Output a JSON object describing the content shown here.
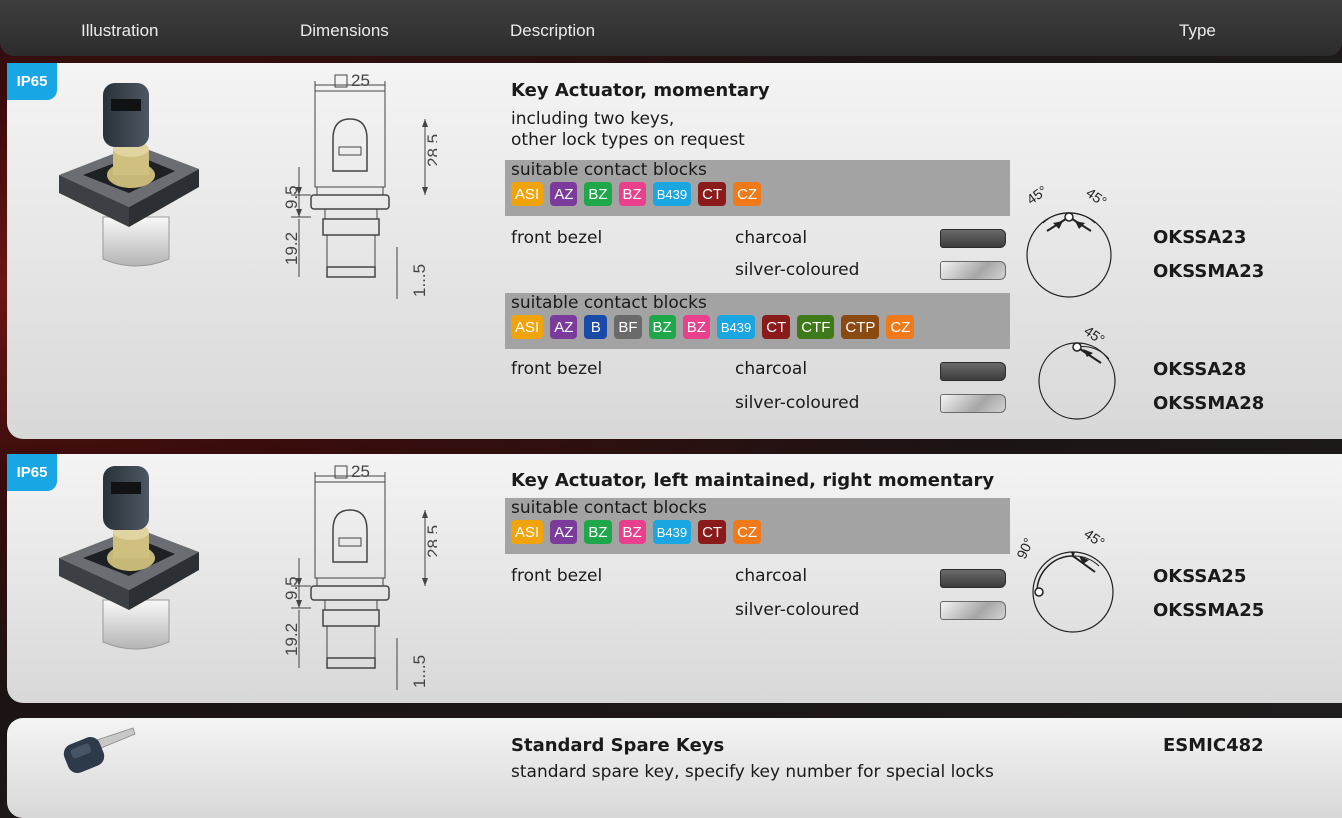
{
  "header": {
    "illustration": "Illustration",
    "dimensions": "Dimensions",
    "description": "Description",
    "type": "Type"
  },
  "dims": {
    "square": "25",
    "h_top": "28.5",
    "h_mid": "9.5",
    "h_bottom": "19.2",
    "h_range": "1...5"
  },
  "products": [
    {
      "badge": "IP65",
      "title": "Key Actuator, momentary",
      "desc1": "including two keys,",
      "desc2": "other lock types on request",
      "groups": [
        {
          "label": "suitable contact blocks",
          "chips": [
            {
              "text": "ASI",
              "color": "#f0a30a"
            },
            {
              "text": "AZ",
              "color": "#7a3b9a"
            },
            {
              "text": "BZ",
              "color": "#1ea84a"
            },
            {
              "text": "BZ",
              "color": "#e8408c"
            },
            {
              "text": "B439",
              "color": "#1aa6e0"
            },
            {
              "text": "CT",
              "color": "#8b1a1a"
            },
            {
              "text": "CZ",
              "color": "#f07a1a"
            }
          ],
          "bezel_label": "front bezel",
          "charcoal": "charcoal",
          "silver": "silver-coloured",
          "type_charcoal": "OKSSA23",
          "type_silver": "OKSSMA23",
          "angle_left": "45°",
          "angle_right": "45°"
        },
        {
          "label": "suitable contact blocks",
          "chips": [
            {
              "text": "ASI",
              "color": "#f0a30a"
            },
            {
              "text": "AZ",
              "color": "#7a3b9a"
            },
            {
              "text": "B",
              "color": "#1a4aa8"
            },
            {
              "text": "BF",
              "color": "#6a6a6a"
            },
            {
              "text": "BZ",
              "color": "#1ea84a"
            },
            {
              "text": "BZ",
              "color": "#e8408c"
            },
            {
              "text": "B439",
              "color": "#1aa6e0"
            },
            {
              "text": "CT",
              "color": "#8b1a1a"
            },
            {
              "text": "CTF",
              "color": "#3e7a1a"
            },
            {
              "text": "CTP",
              "color": "#8a4a12"
            },
            {
              "text": "CZ",
              "color": "#f07a1a"
            }
          ],
          "bezel_label": "front bezel",
          "charcoal": "charcoal",
          "silver": "silver-coloured",
          "type_charcoal": "OKSSA28",
          "type_silver": "OKSSMA28",
          "angle_right": "45°"
        }
      ]
    },
    {
      "badge": "IP65",
      "title": "Key Actuator, left maintained, right momentary",
      "groups": [
        {
          "label": "suitable contact blocks",
          "chips": [
            {
              "text": "ASI",
              "color": "#f0a30a"
            },
            {
              "text": "AZ",
              "color": "#7a3b9a"
            },
            {
              "text": "BZ",
              "color": "#1ea84a"
            },
            {
              "text": "BZ",
              "color": "#e8408c"
            },
            {
              "text": "B439",
              "color": "#1aa6e0"
            },
            {
              "text": "CT",
              "color": "#8b1a1a"
            },
            {
              "text": "CZ",
              "color": "#f07a1a"
            }
          ],
          "bezel_label": "front bezel",
          "charcoal": "charcoal",
          "silver": "silver-coloured",
          "type_charcoal": "OKSSA25",
          "type_silver": "OKSSMA25",
          "angle_left": "90°",
          "angle_right": "45°"
        }
      ]
    },
    {
      "title": "Standard Spare Keys",
      "desc1": "standard spare key, specify key number for special locks",
      "type": "ESMIC482"
    }
  ]
}
